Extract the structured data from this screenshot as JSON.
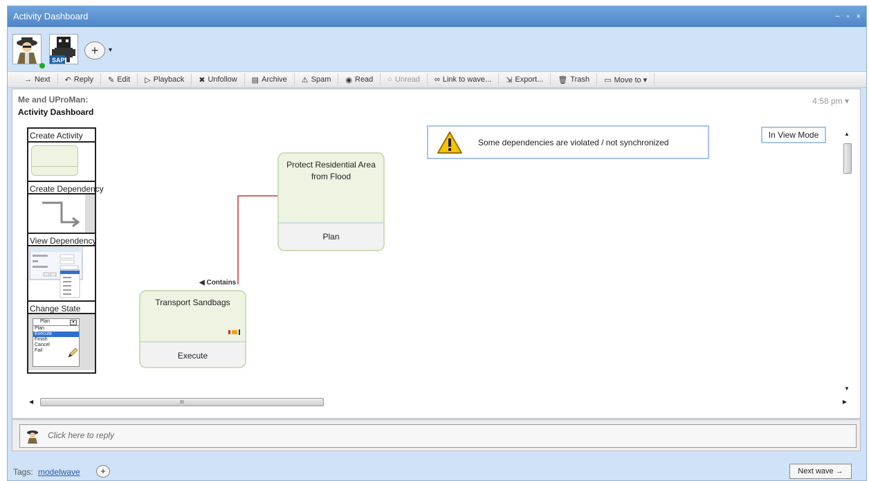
{
  "window": {
    "title": "Activity Dashboard",
    "controls": [
      "−",
      "▫",
      "×"
    ]
  },
  "participants": {
    "add_label": "+",
    "avatar_badge": "SAP"
  },
  "toolbar": [
    {
      "label": "Next",
      "icon": "→",
      "enabled": true
    },
    {
      "label": "Reply",
      "icon": "↶",
      "enabled": true
    },
    {
      "label": "Edit",
      "icon": "✎",
      "enabled": true
    },
    {
      "label": "Playback",
      "icon": "▷",
      "enabled": true
    },
    {
      "label": "Unfollow",
      "icon": "✖",
      "enabled": true
    },
    {
      "label": "Archive",
      "icon": "▤",
      "enabled": true
    },
    {
      "label": "Spam",
      "icon": "⚠",
      "enabled": true
    },
    {
      "label": "Read",
      "icon": "◉",
      "enabled": true
    },
    {
      "label": "Unread",
      "icon": "○",
      "enabled": false
    },
    {
      "label": "Link to wave...",
      "icon": "∞",
      "enabled": true
    },
    {
      "label": "Export...",
      "icon": "⇲",
      "enabled": true
    },
    {
      "label": "Trash",
      "icon": "🗑",
      "enabled": true
    },
    {
      "label": "Move to ▾",
      "icon": "▭",
      "enabled": true
    }
  ],
  "wave": {
    "author": "Me and UProMan:",
    "title": "Activity Dashboard",
    "time": "4:58 pm ▾"
  },
  "palette": {
    "create_activity": "Create Activity",
    "create_dependency": "Create Dependency",
    "view_dependency": "View Dependency",
    "change_state": "Change State",
    "state_menu": {
      "selected": "Plan",
      "options": [
        "Plan",
        "Execute",
        "Finish",
        "Cancel",
        "Fail"
      ]
    }
  },
  "warning": {
    "text": "Some dependencies are violated / not synchronized"
  },
  "view_mode": "In View Mode",
  "nodes": [
    {
      "title": "Protect Residential Area from Flood",
      "state": "Plan"
    },
    {
      "title": "Transport Sandbags",
      "state": "Execute"
    }
  ],
  "dependency": {
    "label": "◀ Contains"
  },
  "scroll": {
    "h_grip": "III"
  },
  "reply": {
    "placeholder": "Click here to reply"
  },
  "footer": {
    "tags_label": "Tags:",
    "tag": "modelwave",
    "add_tag": "+",
    "next_wave": "Next wave →"
  },
  "colors": {
    "title_bar": "#5b92d1",
    "panel_bg": "#cfe2f7",
    "node_fill": "#eef3e2",
    "node_border": "#cdddb8",
    "dependency_line": "#c0392b",
    "warning_yellow": "#f5c400"
  }
}
